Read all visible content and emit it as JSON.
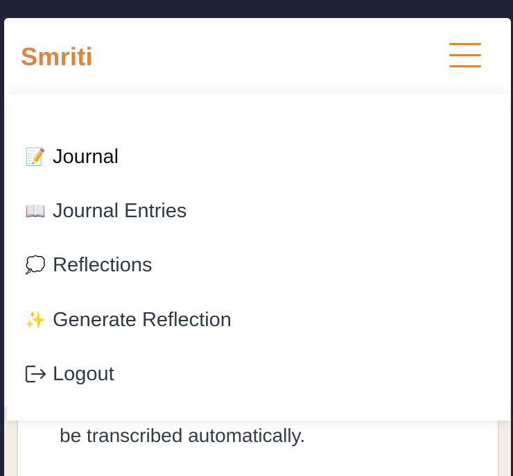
{
  "header": {
    "brand": "Smriti",
    "menu_icon": "hamburger-menu-icon"
  },
  "menu": {
    "items": [
      {
        "icon": "📝",
        "icon_name": "memo-icon",
        "label": "Journal",
        "active": true
      },
      {
        "icon": "📖",
        "icon_name": "open-book-icon",
        "label": "Journal Entries",
        "active": false
      },
      {
        "icon": "💭",
        "icon_name": "thought-balloon-icon",
        "label": "Reflections",
        "active": false
      },
      {
        "icon": "✨",
        "icon_name": "sparkles-icon",
        "label": "Generate Reflection",
        "active": false
      },
      {
        "icon": "",
        "icon_name": "logout-icon",
        "label": "Logout",
        "active": false
      }
    ]
  },
  "behind": {
    "text": "be transcribed automatically."
  },
  "colors": {
    "brand": "#dd853a",
    "text": "#2f3848",
    "chrome_background": "#1f2335"
  }
}
